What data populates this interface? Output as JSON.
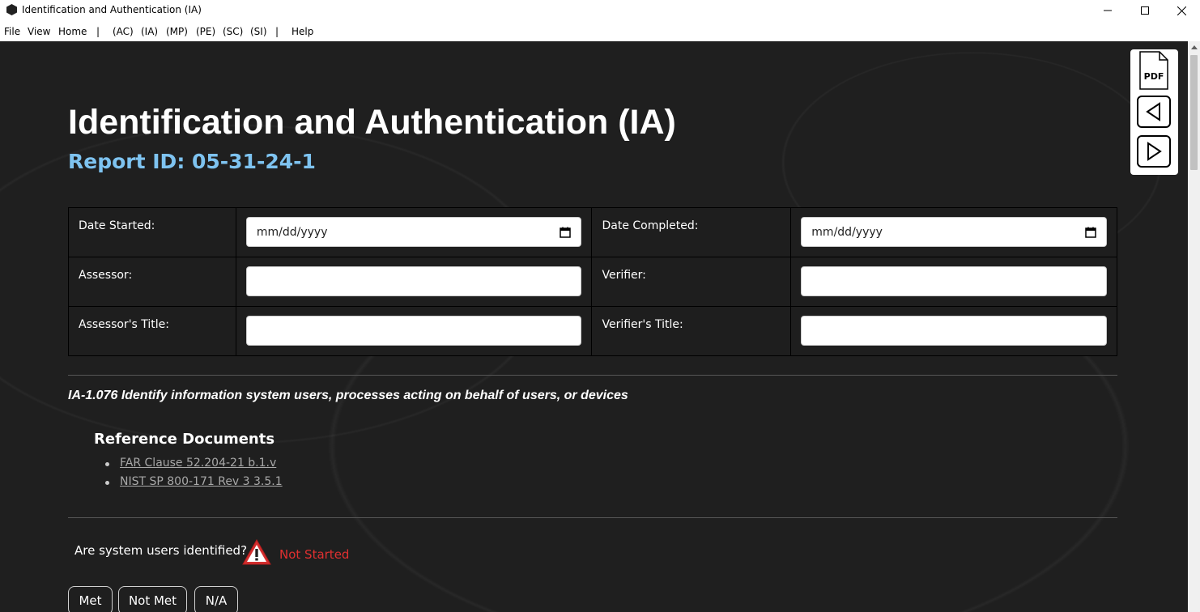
{
  "window": {
    "title": "Identification and Authentication (IA)"
  },
  "menu": {
    "file": "File",
    "view": "View",
    "home": "Home",
    "sep1": "|",
    "ac": "(AC)",
    "ia": "(IA)",
    "mp": "(MP)",
    "pe": "(PE)",
    "sc": "(SC)",
    "si": "(SI)",
    "sep2": "|",
    "help": "Help"
  },
  "page": {
    "title": "Identification and Authentication (IA)",
    "report_id": "Report ID: 05-31-24-1"
  },
  "form": {
    "date_started_label": "Date Started:",
    "date_started_placeholder": "mm/dd/yyyy",
    "date_completed_label": "Date Completed:",
    "date_completed_placeholder": "mm/dd/yyyy",
    "assessor_label": "Assessor:",
    "assessor_value": "",
    "verifier_label": "Verifier:",
    "verifier_value": "",
    "assessor_title_label": "Assessor's Title:",
    "assessor_title_value": "",
    "verifier_title_label": "Verifier's Title:",
    "verifier_title_value": ""
  },
  "control": {
    "title": "IA-1.076 Identify information system users, processes acting on behalf of users, or devices",
    "ref_heading": "Reference Documents",
    "references": [
      "FAR Clause 52.204-21 b.1.v",
      "NIST SP 800-171 Rev 3 3.5.1"
    ],
    "question": "Are system users identified?",
    "status": "Not Started",
    "status_color": "#e03030",
    "buttons": {
      "met": "Met",
      "not_met": "Not Met",
      "na": "N/A"
    }
  },
  "float_panel": {
    "pdf_label": "PDF"
  },
  "colors": {
    "background": "#1f1f1f",
    "report_id": "#7ec3f0"
  }
}
